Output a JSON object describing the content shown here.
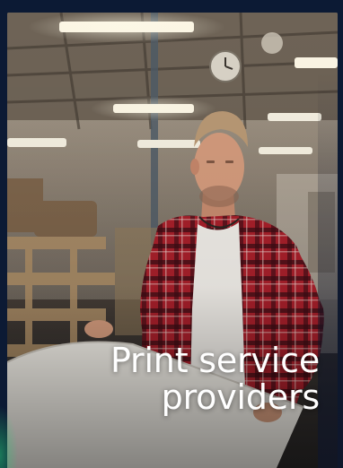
{
  "card": {
    "title_line1": "Print service",
    "title_line2": "providers"
  },
  "colors": {
    "background": "#0c1a34",
    "text": "#ffffff",
    "accent_glow": "#28c878"
  },
  "image": {
    "subject": "photo-of-worker-reviewing-print-in-workshop"
  }
}
